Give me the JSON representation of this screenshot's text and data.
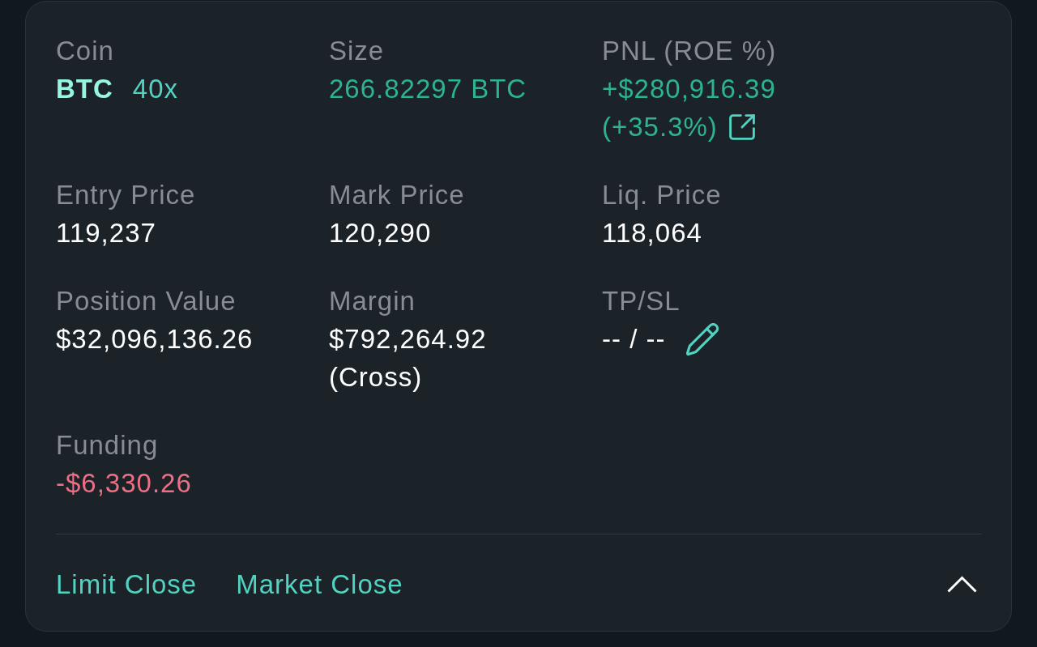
{
  "position": {
    "fields": [
      {
        "kind": "coin",
        "label": "Coin",
        "symbol": "BTC",
        "leverage": "40x"
      },
      {
        "kind": "plain",
        "label": "Size",
        "color": "#2db48e",
        "lines": [
          "266.82297 BTC"
        ]
      },
      {
        "kind": "pnl",
        "label": "PNL (ROE %)",
        "color": "#2db48e",
        "lines": [
          "+$280,916.39",
          "(+35.3%)"
        ]
      },
      {
        "kind": "plain",
        "label": "Entry Price",
        "color": "#ffffff",
        "lines": [
          "119,237"
        ]
      },
      {
        "kind": "plain",
        "label": "Mark Price",
        "color": "#ffffff",
        "lines": [
          "120,290"
        ]
      },
      {
        "kind": "plain",
        "label": "Liq. Price",
        "color": "#ffffff",
        "lines": [
          "118,064"
        ]
      },
      {
        "kind": "plain",
        "label": "Position Value",
        "color": "#ffffff",
        "lines": [
          "$32,096,136.26"
        ]
      },
      {
        "kind": "plain",
        "label": "Margin",
        "color": "#ffffff",
        "lines": [
          "$792,264.92",
          "(Cross)"
        ]
      },
      {
        "kind": "tpsl",
        "label": "TP/SL",
        "color": "#ffffff",
        "lines": [
          "-- / --"
        ]
      },
      {
        "kind": "plain",
        "label": "Funding",
        "color": "#ec6f86",
        "lines": [
          "-$6,330.26"
        ]
      }
    ],
    "actions": [
      "Limit Close",
      "Market Close"
    ],
    "expanded": true
  }
}
